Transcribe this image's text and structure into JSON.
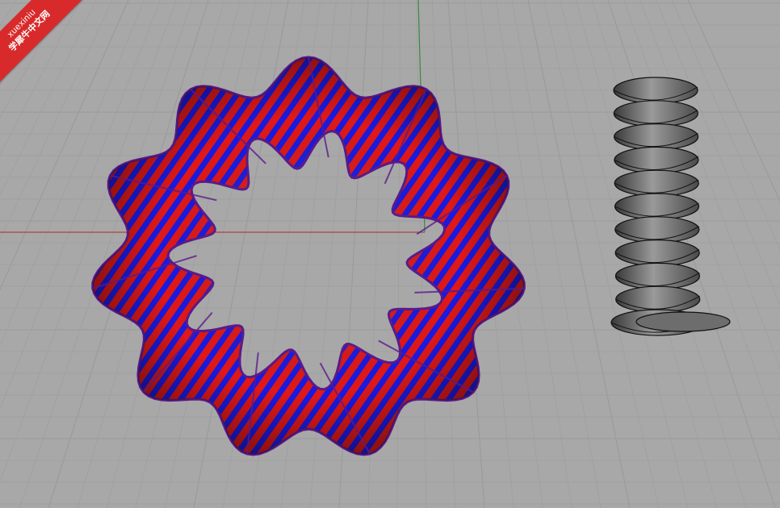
{
  "viewport": {
    "background_color": "#a8a8a8",
    "grid_minor_color": "#9e9e9e",
    "grid_major_color": "#9a9a9a",
    "x_axis_color": "#b04040",
    "y_axis_color": "#3a8a3a"
  },
  "watermark": {
    "line1": "xuexiniu",
    "line2": "学犀牛中文网",
    "color": "#d82a2a"
  },
  "objects": {
    "twisted_torus": {
      "stripe_colors": [
        "#e01818",
        "#1a1ae0"
      ],
      "edge_color": "#5a1a8a",
      "twist_count": 11
    },
    "helix_sweep": {
      "fill_color": "#777777",
      "line_color": "#111111",
      "turns": 11
    }
  }
}
